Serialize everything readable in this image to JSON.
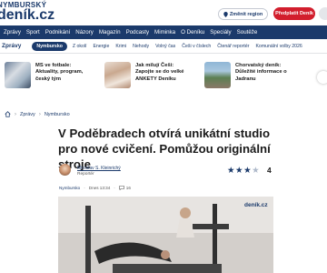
{
  "header": {
    "logo_small": "NYMBURSKÝ",
    "logo_big": "deník.cz",
    "region_button": "Změnit region",
    "subscribe_button": "Předplatit Deník"
  },
  "main_nav": [
    "Zprávy",
    "Sport",
    "Podnikání",
    "Názory",
    "Magazín",
    "Podcasty",
    "Miminka",
    "O Deníku",
    "Speciály",
    "Soutěže"
  ],
  "sub_nav": {
    "section": "Zprávy",
    "items": [
      "Nymbursko",
      "Z okolí",
      "Energie",
      "Krimi",
      "Nehody",
      "Volný čas",
      "Češi v číslech",
      "Čtenář reportér",
      "Komunální volby 2026"
    ]
  },
  "teasers": [
    {
      "text": "MS ve fotbale: Aktuality, program, český tým"
    },
    {
      "text": "Jak milují Češi: Zapojte se do velké ANKETY Deníku"
    },
    {
      "text": "Chorvatský deník: Důležité informace o Jadranu"
    }
  ],
  "breadcrumb": [
    "Zprávy",
    "Nymbursko"
  ],
  "article": {
    "title": "V Poděbradech otvírá unikátní studio pro nové cvičení. Pomůžou originální stroje",
    "author_name": "Miroslav S. Kleinrichý",
    "author_role": "Reportér",
    "rating_value": "4",
    "rating_stars": 3.5,
    "category": "Nymbursko",
    "date": "Dnes 13:34",
    "comments": "16",
    "photo_watermark": "deník.cz"
  },
  "colors": {
    "brand": "#1b3a6b",
    "accent": "#d21e2d"
  }
}
